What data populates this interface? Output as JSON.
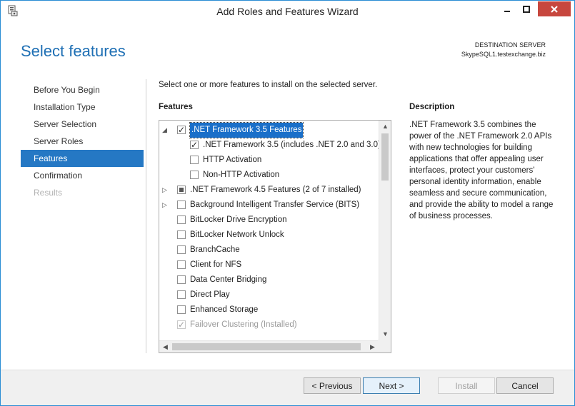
{
  "window": {
    "title": "Add Roles and Features Wizard",
    "icon": "server-manager-icon"
  },
  "header": {
    "page_title": "Select features",
    "destination_label": "DESTINATION SERVER",
    "destination_server": "SkypeSQL1.testexchange.biz"
  },
  "nav": {
    "items": [
      {
        "label": "Before You Begin",
        "state": "normal"
      },
      {
        "label": "Installation Type",
        "state": "normal"
      },
      {
        "label": "Server Selection",
        "state": "normal"
      },
      {
        "label": "Server Roles",
        "state": "normal"
      },
      {
        "label": "Features",
        "state": "active"
      },
      {
        "label": "Confirmation",
        "state": "normal"
      },
      {
        "label": "Results",
        "state": "disabled"
      }
    ]
  },
  "main": {
    "intro": "Select one or more features to install on the selected server.",
    "features_label": "Features",
    "features": [
      {
        "label": ".NET Framework 3.5 Features",
        "expander": "expanded",
        "check": "checked",
        "level": 0,
        "selected": true
      },
      {
        "label": ".NET Framework 3.5 (includes .NET 2.0 and 3.0)",
        "expander": "",
        "check": "checked",
        "level": 1
      },
      {
        "label": "HTTP Activation",
        "expander": "",
        "check": "unchecked",
        "level": 1
      },
      {
        "label": "Non-HTTP Activation",
        "expander": "",
        "check": "unchecked",
        "level": 1
      },
      {
        "label": ".NET Framework 4.5 Features (2 of 7 installed)",
        "expander": "collapsed",
        "check": "partial",
        "level": 0
      },
      {
        "label": "Background Intelligent Transfer Service (BITS)",
        "expander": "collapsed",
        "check": "unchecked",
        "level": 0
      },
      {
        "label": "BitLocker Drive Encryption",
        "expander": "",
        "check": "unchecked",
        "level": 0
      },
      {
        "label": "BitLocker Network Unlock",
        "expander": "",
        "check": "unchecked",
        "level": 0
      },
      {
        "label": "BranchCache",
        "expander": "",
        "check": "unchecked",
        "level": 0
      },
      {
        "label": "Client for NFS",
        "expander": "",
        "check": "unchecked",
        "level": 0
      },
      {
        "label": "Data Center Bridging",
        "expander": "",
        "check": "unchecked",
        "level": 0
      },
      {
        "label": "Direct Play",
        "expander": "",
        "check": "unchecked",
        "level": 0
      },
      {
        "label": "Enhanced Storage",
        "expander": "",
        "check": "unchecked",
        "level": 0
      },
      {
        "label": "Failover Clustering (Installed)",
        "expander": "",
        "check": "checked-disabled",
        "level": 0
      }
    ],
    "description_label": "Description",
    "description": ".NET Framework 3.5 combines the power of the .NET Framework 2.0 APIs with new technologies for building applications that offer appealing user interfaces, protect your customers' personal identity information, enable seamless and secure communication, and provide the ability to model a range of business processes."
  },
  "footer": {
    "previous": "< Previous",
    "next": "Next >",
    "install": "Install",
    "cancel": "Cancel"
  }
}
